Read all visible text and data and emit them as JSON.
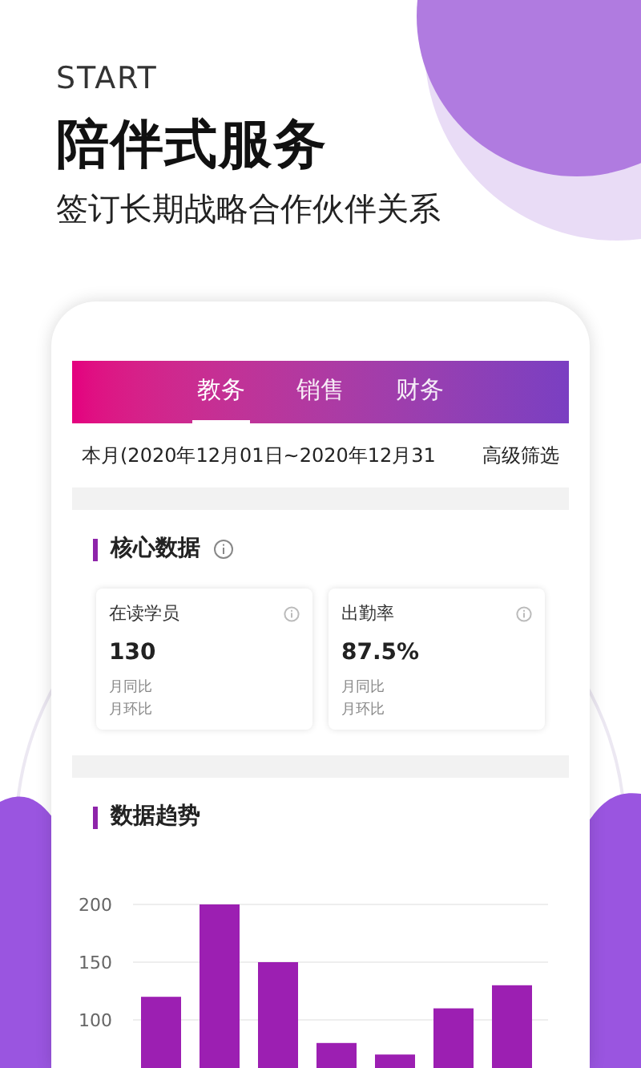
{
  "header": {
    "eyebrow": "START",
    "title": "陪伴式服务",
    "subtitle": "签订长期战略合作伙伴关系"
  },
  "tabs": [
    {
      "label": "教务",
      "selected": true
    },
    {
      "label": "销售",
      "selected": false
    },
    {
      "label": "财务",
      "selected": false
    }
  ],
  "filter": {
    "date_range": "本月(2020年12月01日~2020年12月31",
    "button": "高级筛选"
  },
  "core": {
    "title": "核心数据",
    "cards": [
      {
        "label": "在读学员",
        "value": "130",
        "notes": [
          "月同比",
          "月环比"
        ]
      },
      {
        "label": "出勤率",
        "value": "87.5%",
        "notes": [
          "月同比",
          "月环比"
        ]
      }
    ]
  },
  "trend": {
    "title": "数据趋势",
    "chart_data": {
      "type": "bar",
      "values": [
        120,
        200,
        150,
        80,
        70,
        110,
        130
      ],
      "ylim": [
        0,
        200
      ],
      "yticks": [
        100,
        150,
        200
      ]
    }
  }
}
